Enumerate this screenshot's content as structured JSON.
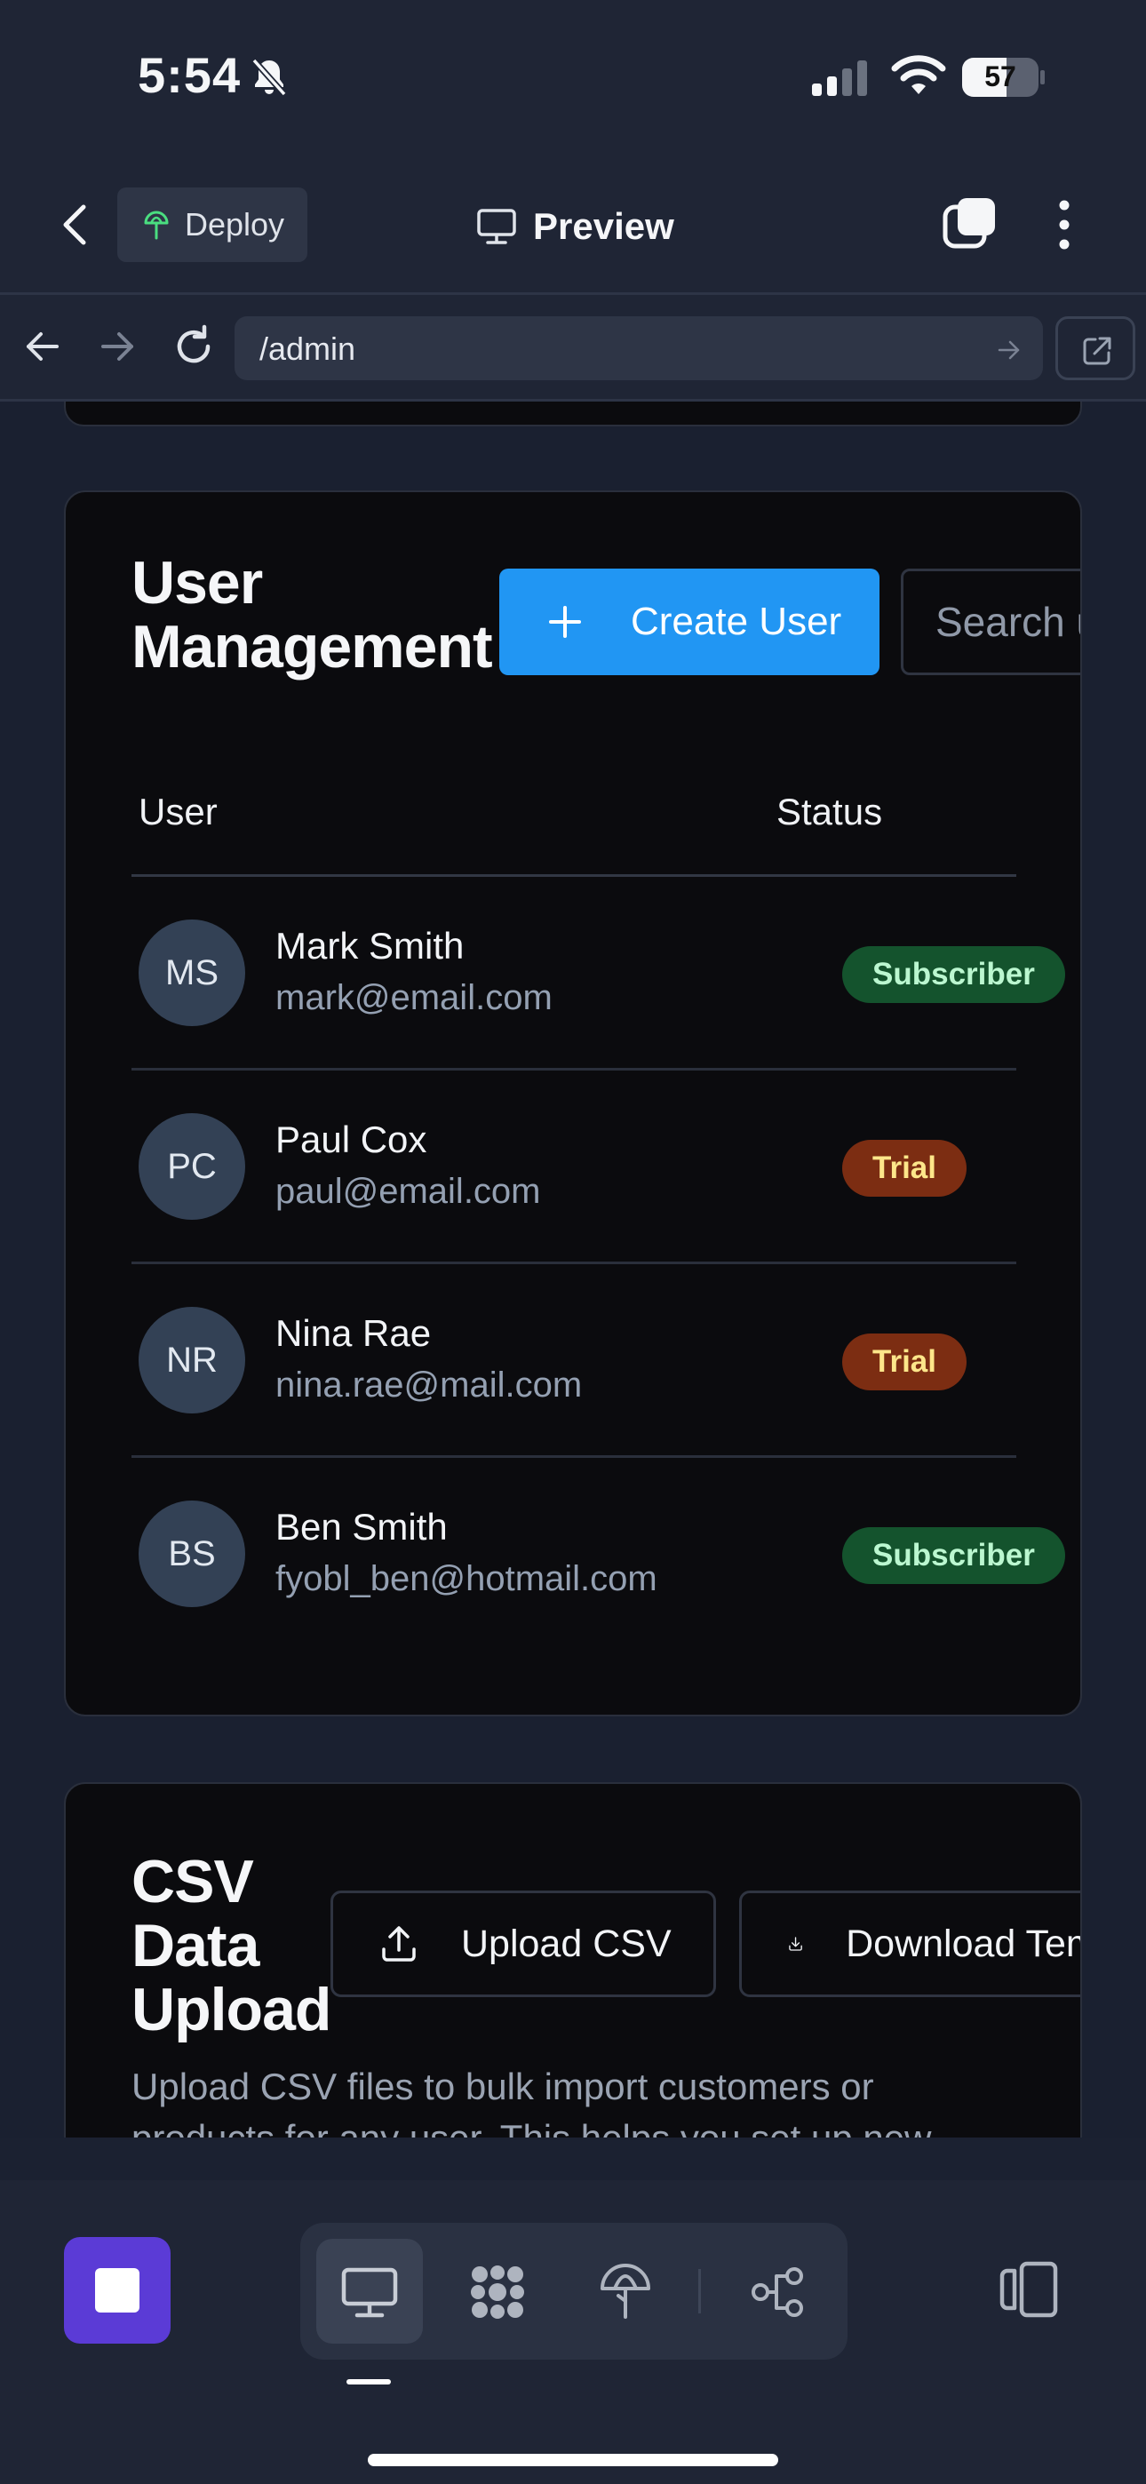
{
  "status_bar": {
    "time": "5:54",
    "battery": "57"
  },
  "app_bar": {
    "deploy_label": "Deploy",
    "title": "Preview"
  },
  "browser": {
    "url": "/admin"
  },
  "user_management": {
    "title": "User Management",
    "create_button": "Create User",
    "search_placeholder": "Search users...",
    "columns": [
      "User",
      "Status"
    ],
    "users": [
      {
        "initials": "MS",
        "name": "Mark Smith",
        "email": "mark@email.com",
        "status": "Subscriber"
      },
      {
        "initials": "PC",
        "name": "Paul Cox",
        "email": "paul@email.com",
        "status": "Trial"
      },
      {
        "initials": "NR",
        "name": "Nina Rae",
        "email": "nina.rae@mail.com",
        "status": "Trial"
      },
      {
        "initials": "BS",
        "name": "Ben Smith",
        "email": "fyobl_ben@hotmail.com",
        "status": "Subscriber"
      }
    ]
  },
  "csv_upload": {
    "title": "CSV Data Upload",
    "upload_button": "Upload CSV",
    "download_button": "Download Template",
    "description": "Upload CSV files to bulk import customers or products for any user. This helps you set up new"
  },
  "dock": {
    "icons": [
      "desktop-icon",
      "grid-icon",
      "deploy-icon",
      "workflow-icon"
    ],
    "active_index": 0
  },
  "colors": {
    "primary": "#2196f3",
    "stop": "#5b3bd6",
    "subscriber_bg": "#14532d",
    "trial_bg": "#7c2d12"
  }
}
